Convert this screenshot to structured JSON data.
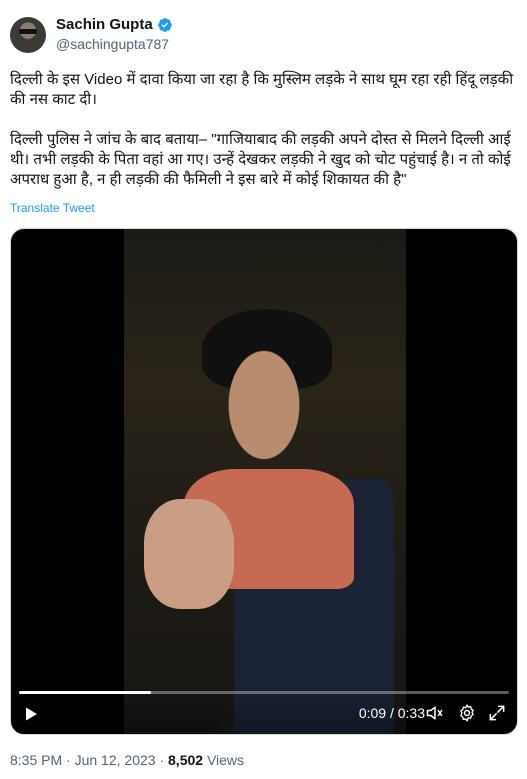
{
  "author": {
    "display_name": "Sachin Gupta",
    "handle": "@sachingupta787"
  },
  "tweet": {
    "line_1": "दिल्ली के इस Video में दावा किया जा रहा है कि मुस्लिम लड़के ने साथ घूम रहा रही हिंदू लड़की की नस काट दी।",
    "line_2": "दिल्ली पुलिस ने जांच के बाद बताया– \"गाजियाबाद की लड़की अपने दोस्त से मिलने दिल्ली आई थी। तभी लड़की के पिता वहां आ गए। उन्हें देखकर लड़की ने खुद को चोट पहुंचाई है। न तो कोई अपराध हुआ है, न ही लड़की की फैमिली ने इस बारे में कोई शिकायत की है\"",
    "translate_label": "Translate Tweet"
  },
  "video": {
    "current_time": "0:09",
    "duration": "0:33",
    "time_display": "0:09 / 0:33",
    "progress_fraction": 0.27
  },
  "meta": {
    "time": "8:35 PM",
    "separator": "·",
    "date": "Jun 12, 2023",
    "views_count": "8,502",
    "views_label": "Views"
  },
  "colors": {
    "accent": "#1d9bf0",
    "text": "#0f1419",
    "muted": "#536471"
  }
}
